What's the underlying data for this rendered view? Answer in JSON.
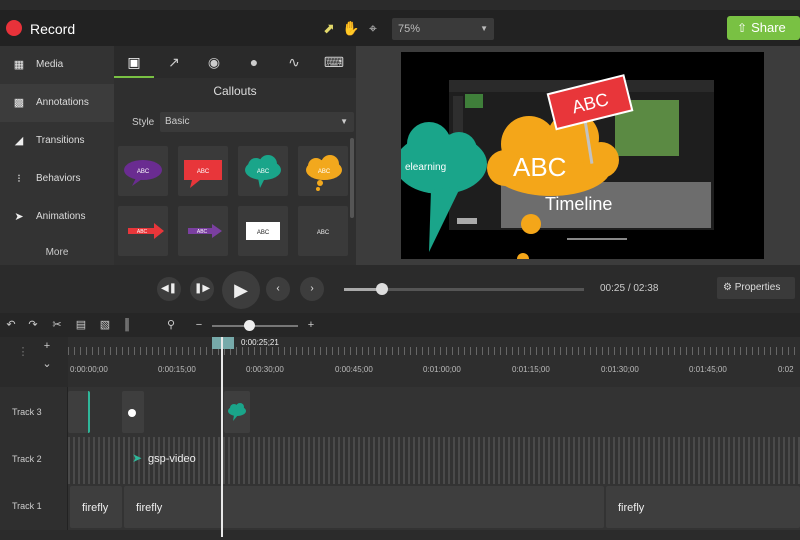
{
  "app": {
    "record_label": "Record"
  },
  "toolbar": {
    "tools": [
      "pointer-tool",
      "hand-tool",
      "crop-tool"
    ],
    "zoom_value": "75%",
    "share_label": "Share"
  },
  "sidebar": {
    "items": [
      {
        "label": "Media",
        "icon": "media-icon"
      },
      {
        "label": "Annotations",
        "icon": "annotation-icon"
      },
      {
        "label": "Transitions",
        "icon": "transition-icon"
      },
      {
        "label": "Behaviors",
        "icon": "behaviors-icon"
      },
      {
        "label": "Animations",
        "icon": "animations-icon"
      }
    ],
    "more_label": "More"
  },
  "panel": {
    "tabs": [
      "callout-tab",
      "arrow-tab",
      "shape-tab",
      "blur-tab",
      "sketch-tab",
      "keystroke-tab"
    ],
    "title": "Callouts",
    "style_label": "Style",
    "style_value": "Basic",
    "thumbs": [
      {
        "text": "ABC",
        "color": "#6a2c91"
      },
      {
        "text": "ABC",
        "color": "#e8363a"
      },
      {
        "text": "ABC",
        "color": "#1aa58a"
      },
      {
        "text": "ABC",
        "color": "#f2a81d"
      },
      {
        "text": "ABC",
        "color": "#e8363a"
      },
      {
        "text": "ABC",
        "color": "#7a3fa0"
      },
      {
        "text": "ABC",
        "color": "#ffffff"
      },
      {
        "text": "ABC",
        "color": "#3a3a3a"
      }
    ]
  },
  "canvas": {
    "callout_green_text": "elearning",
    "callout_yellow_text": "ABC",
    "sign_text": "ABC",
    "timeline_text": "Timeline"
  },
  "playback": {
    "time_current": "00:25",
    "time_separator": "/",
    "time_total": "02:38",
    "progress": 0.16,
    "properties_label": "Properties"
  },
  "timeline": {
    "playhead_time": "0:00:25;21",
    "ruler_labels": [
      "0:00:00;00",
      "0:00:15;00",
      "0:00:30;00",
      "0:00:45;00",
      "0:01:00;00",
      "0:01:15;00",
      "0:01:30;00",
      "0:01:45;00",
      "0:02"
    ],
    "tracks": [
      {
        "name": "Track 3"
      },
      {
        "name": "Track 2",
        "clip_label": "gsp-video"
      },
      {
        "name": "Track 1",
        "clips": [
          "firefly",
          "firefly",
          "firefly"
        ]
      }
    ]
  },
  "colors": {
    "accent": "#79c143",
    "record": "#e8323a"
  }
}
